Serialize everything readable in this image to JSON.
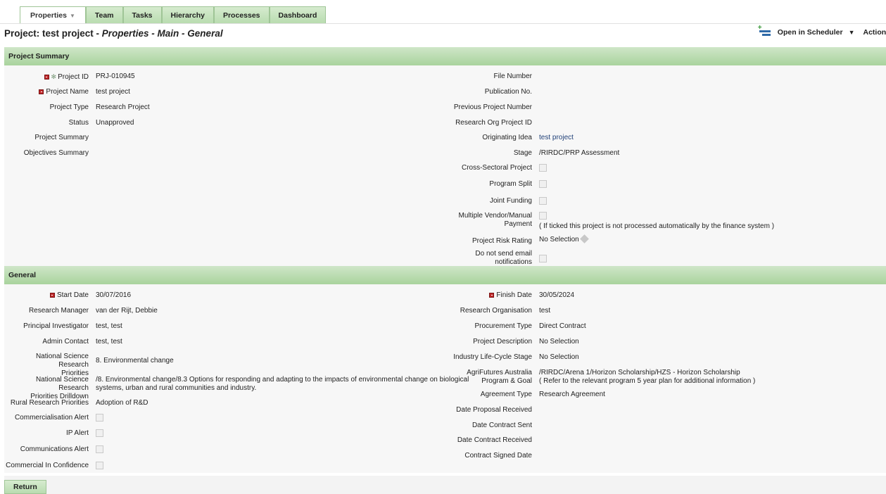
{
  "tabs": [
    {
      "label": "Properties",
      "active": true
    },
    {
      "label": "Team"
    },
    {
      "label": "Tasks"
    },
    {
      "label": "Hierarchy"
    },
    {
      "label": "Processes"
    },
    {
      "label": "Dashboard"
    }
  ],
  "title": {
    "main": "Project: test project - ",
    "sub": "Properties - Main - General"
  },
  "toolbar": {
    "open_scheduler": "Open in Scheduler",
    "actions": "Actions"
  },
  "sections": {
    "summary": "Project Summary",
    "general": "General"
  },
  "summary_left": {
    "project_id_label": "Project ID",
    "project_id": "PRJ-010945",
    "project_name_label": "Project Name",
    "project_name": "test project",
    "project_type_label": "Project Type",
    "project_type": "Research Project",
    "status_label": "Status",
    "status": "Unapproved",
    "project_summary_label": "Project Summary",
    "objectives_summary_label": "Objectives Summary"
  },
  "summary_right": {
    "file_number_label": "File Number",
    "publication_no_label": "Publication No.",
    "previous_project_number_label": "Previous Project Number",
    "research_org_project_id_label": "Research Org Project ID",
    "originating_idea_label": "Originating Idea",
    "originating_idea": "test project",
    "stage_label": "Stage",
    "stage": "/RIRDC/PRP Assessment",
    "cross_sectoral_label": "Cross-Sectoral Project",
    "program_split_label": "Program Split",
    "joint_funding_label": "Joint Funding",
    "multiple_vendor_label_1": "Multiple Vendor/Manual",
    "multiple_vendor_label_2": "Payment",
    "multiple_vendor_note": "( If ticked this project is not processed automatically by the finance system )",
    "risk_rating_label": "Project Risk Rating",
    "risk_rating": "No Selection",
    "no_email_label_1": "Do not send email",
    "no_email_label_2": "notifications"
  },
  "general_left": {
    "start_date_label": "Start Date",
    "start_date": "30/07/2016",
    "research_manager_label": "Research Manager",
    "research_manager": "van der Rijt, Debbie",
    "principal_investigator_label": "Principal Investigator",
    "principal_investigator": "test, test",
    "admin_contact_label": "Admin Contact",
    "admin_contact": "test, test",
    "nsrp_label_1": "National Science Research",
    "nsrp_label_2": "Priorities",
    "nsrp": "8. Environmental change",
    "nsrpd_label_1": "National Science Research",
    "nsrpd_label_2": "Priorities Drilldown",
    "nsrpd_1": "/8. Environmental change/8.3 Options for responding and adapting to the impacts of environmental change on biological",
    "nsrpd_2": "systems, urban and rural communities and industry.",
    "rrp_label": "Rural Research Priorities",
    "rrp": "Adoption of R&D",
    "commercialisation_label": "Commercialisation Alert",
    "ip_alert_label": "IP Alert",
    "communications_label": "Communications Alert",
    "commercial_confidence_label": "Commercial In Confidence"
  },
  "general_right": {
    "finish_date_label": "Finish Date",
    "finish_date": "30/05/2024",
    "research_org_label": "Research Organisation",
    "research_org": "test",
    "procurement_type_label": "Procurement Type",
    "procurement_type": "Direct Contract",
    "project_description_label": "Project Description",
    "project_description": "No Selection",
    "lifecycle_label": "Industry Life-Cycle Stage",
    "lifecycle": "No Selection",
    "agrifutures_label_1": "AgriFutures Australia",
    "agrifutures_label_2": "Program & Goal",
    "agrifutures_1": "/RIRDC/Arena 1/Horizon Scholarship/HZS - Horizon Scholarship",
    "agrifutures_2": "( Refer to the relevant program 5 year plan for additional information )",
    "agreement_type_label": "Agreement Type",
    "agreement_type": "Research Agreement",
    "date_proposal_label": "Date Proposal Received",
    "date_contract_sent_label": "Date Contract Sent",
    "date_contract_received_label": "Date Contract Received",
    "contract_signed_label": "Contract Signed Date"
  },
  "footer": {
    "return_label": "Return"
  }
}
